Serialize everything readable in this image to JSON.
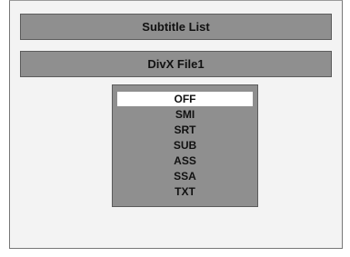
{
  "title": "Subtitle List",
  "file_name": "DivX File1",
  "menu": {
    "selected_index": 0,
    "items": [
      {
        "label": "OFF"
      },
      {
        "label": "SMI"
      },
      {
        "label": "SRT"
      },
      {
        "label": "SUB"
      },
      {
        "label": "ASS"
      },
      {
        "label": "SSA"
      },
      {
        "label": "TXT"
      }
    ]
  }
}
